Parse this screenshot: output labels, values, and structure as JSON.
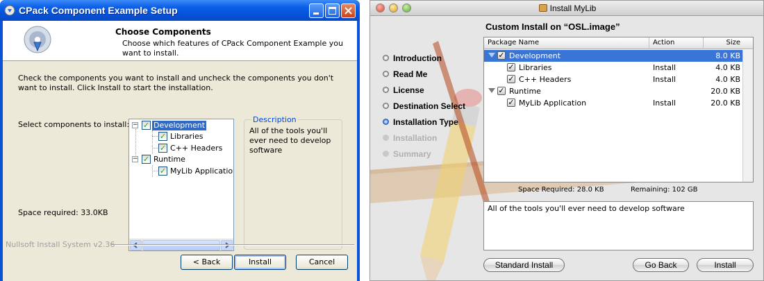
{
  "nsis": {
    "title": "CPack Component Example Setup",
    "header_title": "Choose Components",
    "header_desc": "Choose which features of CPack Component Example you want to install.",
    "intro": "Check the components you want to install and uncheck the components you don't want to install. Click Install to start the installation.",
    "select_label": "Select components to install:",
    "space_required": "Space required: 33.0KB",
    "tree": [
      {
        "label": "Development",
        "expander": "−",
        "checked": true,
        "selected": true
      },
      {
        "label": "Libraries",
        "checked": true
      },
      {
        "label": "C++ Headers",
        "checked": true
      },
      {
        "label": "Runtime",
        "expander": "−",
        "checked": true
      },
      {
        "label": "MyLib Application",
        "checked": true
      }
    ],
    "description_title": "Description",
    "description_text": "All of the tools you'll ever need to develop software",
    "footer_brand": "Nullsoft Install System v2.36",
    "buttons": {
      "back": "< Back",
      "install": "Install",
      "cancel": "Cancel"
    }
  },
  "mac": {
    "title": "Install MyLib",
    "heading": "Custom Install on “OSL.image”",
    "steps": [
      {
        "label": "Introduction",
        "state": "done"
      },
      {
        "label": "Read Me",
        "state": "done"
      },
      {
        "label": "License",
        "state": "done"
      },
      {
        "label": "Destination Select",
        "state": "done"
      },
      {
        "label": "Installation Type",
        "state": "current"
      },
      {
        "label": "Installation",
        "state": "disabled"
      },
      {
        "label": "Summary",
        "state": "disabled"
      }
    ],
    "columns": {
      "name": "Package Name",
      "action": "Action",
      "size": "Size"
    },
    "rows": [
      {
        "name": "Development",
        "action": "",
        "size": "8.0 KB",
        "selected": true
      },
      {
        "name": "Libraries",
        "action": "Install",
        "size": "4.0 KB"
      },
      {
        "name": "C++ Headers",
        "action": "Install",
        "size": "4.0 KB"
      },
      {
        "name": "Runtime",
        "action": "",
        "size": "20.0 KB"
      },
      {
        "name": "MyLib Application",
        "action": "Install",
        "size": "20.0 KB"
      }
    ],
    "check_mark": "✓",
    "space_required": "Space Required:   28.0 KB",
    "remaining": "Remaining:   102 GB",
    "description": "All of the tools you'll ever need to develop software",
    "buttons": {
      "standard": "Standard Install",
      "go_back": "Go Back",
      "install": "Install"
    }
  }
}
